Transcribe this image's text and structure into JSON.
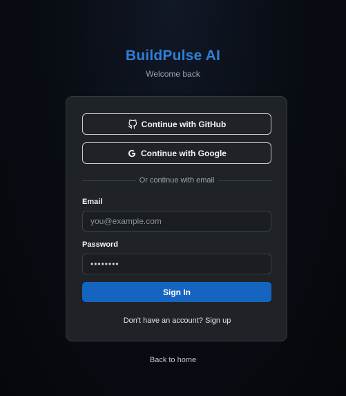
{
  "brand": {
    "name": "BuildPulse AI",
    "tagline": "Welcome back"
  },
  "auth": {
    "github_label": "Continue with GitHub",
    "google_label": "Continue with Google",
    "divider_text": "Or continue with email",
    "email_label": "Email",
    "email_placeholder": "you@example.com",
    "password_label": "Password",
    "password_value": "password",
    "signin_label": "Sign In",
    "signup_prompt": "Don't have an account?",
    "signup_link": "Sign up"
  },
  "footer": {
    "back_link": "Back to home"
  },
  "colors": {
    "brand_accent": "#2f7fd6",
    "primary_button": "#1565c0",
    "card_bg": "#1f2327"
  }
}
